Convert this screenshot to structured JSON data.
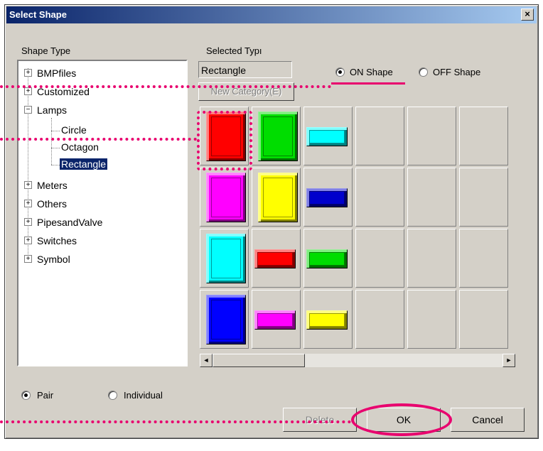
{
  "title": "Select Shape",
  "close_glyph": "×",
  "shape_type_label": "Shape Type",
  "selected_type_label": "Selected Typı",
  "selected_type_value": "Rectangle",
  "new_category_label": "New Category(E)",
  "on_shape": {
    "label": "ON Shape",
    "selected": true
  },
  "off_shape": {
    "label": "OFF Shape",
    "selected": false
  },
  "tree": {
    "items": [
      {
        "label": "BMPfiles",
        "expander": "+"
      },
      {
        "label": "Customized",
        "expander": "+"
      },
      {
        "label": "Lamps",
        "expander": "−"
      },
      {
        "label": "Circle"
      },
      {
        "label": "Octagon"
      },
      {
        "label": "Rectangle",
        "selected": true
      },
      {
        "label": "Meters",
        "expander": "+"
      },
      {
        "label": "Others",
        "expander": "+"
      },
      {
        "label": "PipesandValve",
        "expander": "+"
      },
      {
        "label": "Switches",
        "expander": "+"
      },
      {
        "label": "Symbol",
        "expander": "+"
      }
    ]
  },
  "shape_grid": [
    [
      {
        "kind": "big",
        "color": "#ff0000",
        "selected": true
      },
      {
        "kind": "big",
        "color": "#00dd00"
      },
      {
        "kind": "small",
        "color": "#00ffff"
      }
    ],
    [
      {
        "kind": "big",
        "color": "#ff00ff"
      },
      {
        "kind": "big",
        "color": "#ffff00"
      },
      {
        "kind": "small",
        "color": "#0000cc"
      }
    ],
    [
      {
        "kind": "big",
        "color": "#00ffff"
      },
      {
        "kind": "small",
        "color": "#ff0000"
      },
      {
        "kind": "small",
        "color": "#00dd00"
      }
    ],
    [
      {
        "kind": "big",
        "color": "#0000ff"
      },
      {
        "kind": "small",
        "color": "#ff00ff"
      },
      {
        "kind": "small",
        "color": "#ffff00"
      }
    ]
  ],
  "scroll_left_glyph": "◄",
  "scroll_right_glyph": "►",
  "pair": {
    "label": "Pair",
    "selected": true
  },
  "individual": {
    "label": "Individual",
    "selected": false
  },
  "buttons": {
    "delete": "Delete",
    "ok": "OK",
    "cancel": "Cancel"
  },
  "accent_color": "#e8006e"
}
